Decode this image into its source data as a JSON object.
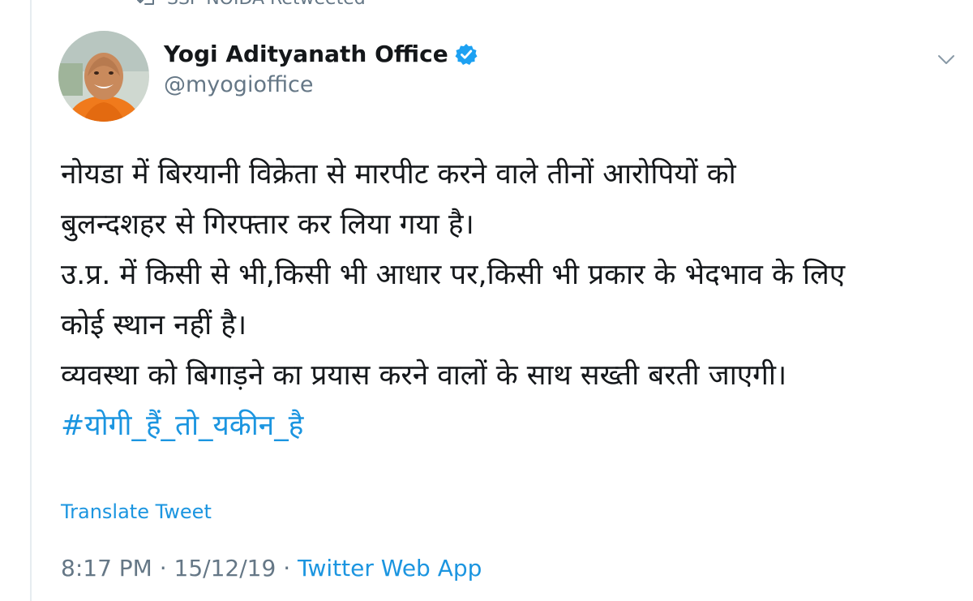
{
  "retweet_context": {
    "label": "SSP NOIDA Retweeted"
  },
  "author": {
    "display_name": "Yogi Adityanath Office",
    "handle": "@myogioffice",
    "verified": true
  },
  "tweet": {
    "lines": [
      "नोयडा में बिरयानी विक्रेता से मारपीट करने वाले तीनों आरोपियों को",
      "बुलन्दशहर से गिरफ्तार कर लिया गया है।",
      "उ.प्र. में किसी से भी,किसी भी आधार पर,किसी भी प्रकार के भेदभाव के लिए",
      "कोई स्थान नहीं है।",
      "व्यवस्था को बिगाड़ने का प्रयास करने वालों के साथ सख्ती बरती जाएगी।"
    ],
    "hashtag": "#योगी_हैं_तो_यकीन_है"
  },
  "translate_label": "Translate Tweet",
  "meta": {
    "time": "8:17 PM",
    "separator": "·",
    "date": "15/12/19",
    "source": "Twitter Web App"
  },
  "colors": {
    "link": "#1b95e0",
    "muted": "#657786",
    "text": "#14171a",
    "verified": "#1da1f2"
  },
  "icons": {
    "retweet": "retweet-icon",
    "verified": "verified-badge-icon",
    "caret": "chevron-down-icon"
  }
}
